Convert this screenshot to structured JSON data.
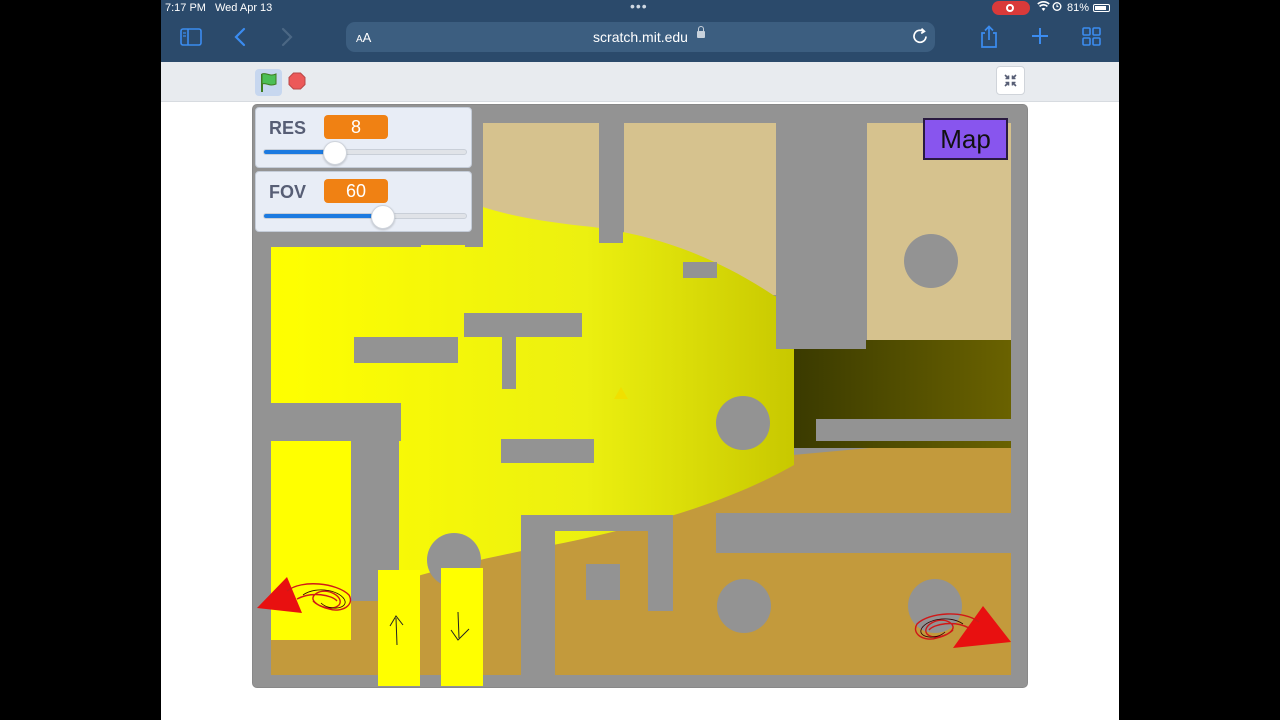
{
  "status_bar": {
    "time": "7:17 PM",
    "date": "Wed Apr 13",
    "battery": "81%"
  },
  "browser": {
    "text_size_label": "AA",
    "url": "scratch.mit.edu",
    "icons": [
      "sidebar-icon",
      "back-icon",
      "forward-icon",
      "share-icon",
      "new-tab-icon",
      "tabs-icon",
      "reload-icon",
      "lock-icon"
    ]
  },
  "scratch_controls": {
    "green_flag": "green-flag-icon",
    "stop": "stop-icon",
    "exit_fullscreen": "shrink-icon"
  },
  "monitors": [
    {
      "label": "RES",
      "value": "8",
      "slider_fraction": 0.35
    },
    {
      "label": "FOV",
      "value": "60",
      "slider_fraction": 0.59
    }
  ],
  "stage": {
    "map_button": "Map",
    "colors": {
      "wall": "#939393",
      "ray_yellow": "#ffff00",
      "floor_tan": "#c8a858",
      "room_beige": "#d8c28c",
      "arrow_red": "#e81010"
    },
    "touch_buttons": [
      "up-arrow-button",
      "down-arrow-button",
      "turn-left-button",
      "turn-right-button"
    ]
  }
}
